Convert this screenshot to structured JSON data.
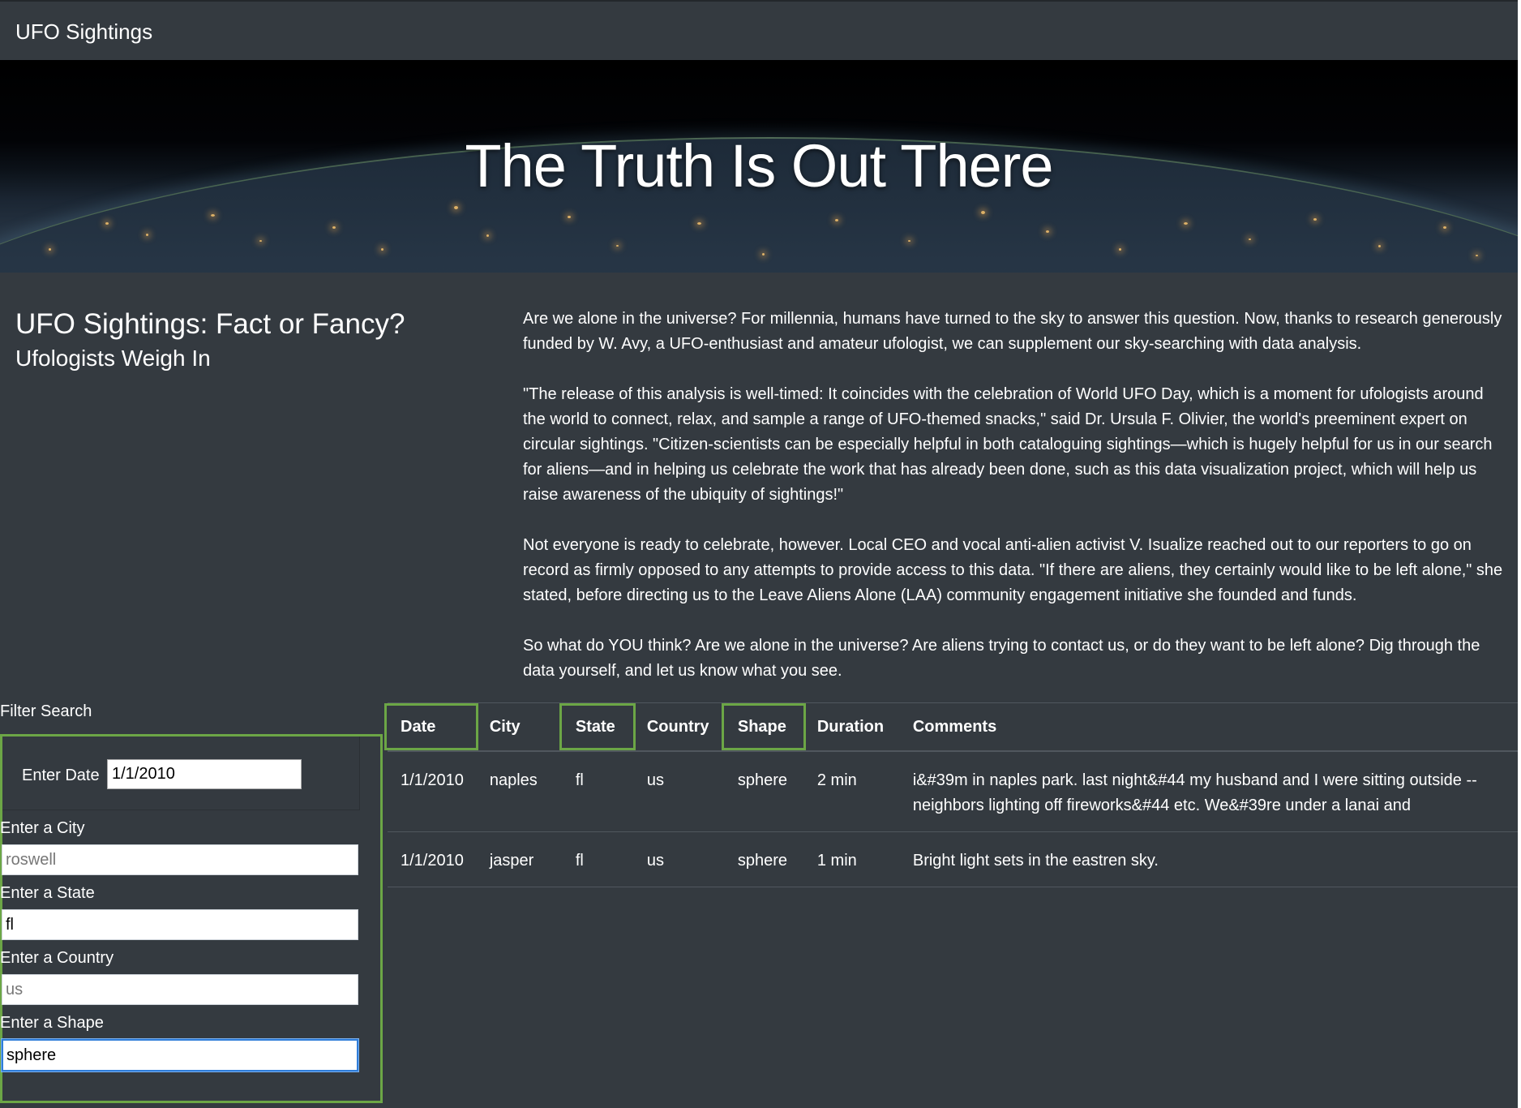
{
  "navbar": {
    "brand": "UFO Sightings"
  },
  "hero": {
    "title": "The Truth Is Out There"
  },
  "headline": {
    "title": "UFO Sightings: Fact or Fancy?",
    "subtitle": "Ufologists Weigh In"
  },
  "article": {
    "paragraphs": [
      "Are we alone in the universe? For millennia, humans have turned to the sky to answer this question. Now, thanks to research generously funded by W. Avy, a UFO-enthusiast and amateur ufologist, we can supplement our sky-searching with data analysis.",
      "\"The release of this analysis is well-timed: It coincides with the celebration of World UFO Day, which is a moment for ufologists around the world to connect, relax, and sample a range of UFO-themed snacks,\" said Dr. Ursula F. Olivier, the world's preeminent expert on circular sightings. \"Citizen-scientists can be especially helpful in both cataloguing sightings—which is hugely helpful for us in our search for aliens—and in helping us celebrate the work that has already been done, such as this data visualization project, which will help us raise awareness of the ubiquity of sightings!\"",
      "Not everyone is ready to celebrate, however. Local CEO and vocal anti-alien activist V. Isualize reached out to our reporters to go on record as firmly opposed to any attempts to provide access to this data. \"If there are aliens, they certainly would like to be left alone,\" she stated, before directing us to the Leave Aliens Alone (LAA) community engagement initiative she founded and funds.",
      "So what do YOU think? Are we alone in the universe? Are aliens trying to contact us, or do they want to be left alone? Dig through the data yourself, and let us know what you see."
    ]
  },
  "filters": {
    "title": "Filter Search",
    "date": {
      "label": "Enter Date",
      "value": "1/1/2010"
    },
    "city": {
      "label": "Enter a City",
      "placeholder": "roswell",
      "value": ""
    },
    "state": {
      "label": "Enter a State",
      "placeholder": "",
      "value": "fl"
    },
    "country": {
      "label": "Enter a Country",
      "placeholder": "us",
      "value": ""
    },
    "shape": {
      "label": "Enter a Shape",
      "placeholder": "",
      "value": "sphere"
    }
  },
  "table": {
    "headers": [
      "Date",
      "City",
      "State",
      "Country",
      "Shape",
      "Duration",
      "Comments"
    ],
    "rows": [
      [
        "1/1/2010",
        "naples",
        "fl",
        "us",
        "sphere",
        "2 min",
        "i&#39m in naples park. last night&#44 my husband and I were sitting outside -- neighbors lighting off fireworks&#44 etc. We&#39re under a lanai and"
      ],
      [
        "1/1/2010",
        "jasper",
        "fl",
        "us",
        "sphere",
        "1 min",
        "Bright light sets in the eastren sky."
      ]
    ]
  },
  "colors": {
    "background": "#343a40",
    "highlight": "#6ca646",
    "focus": "#2f7dd9"
  }
}
